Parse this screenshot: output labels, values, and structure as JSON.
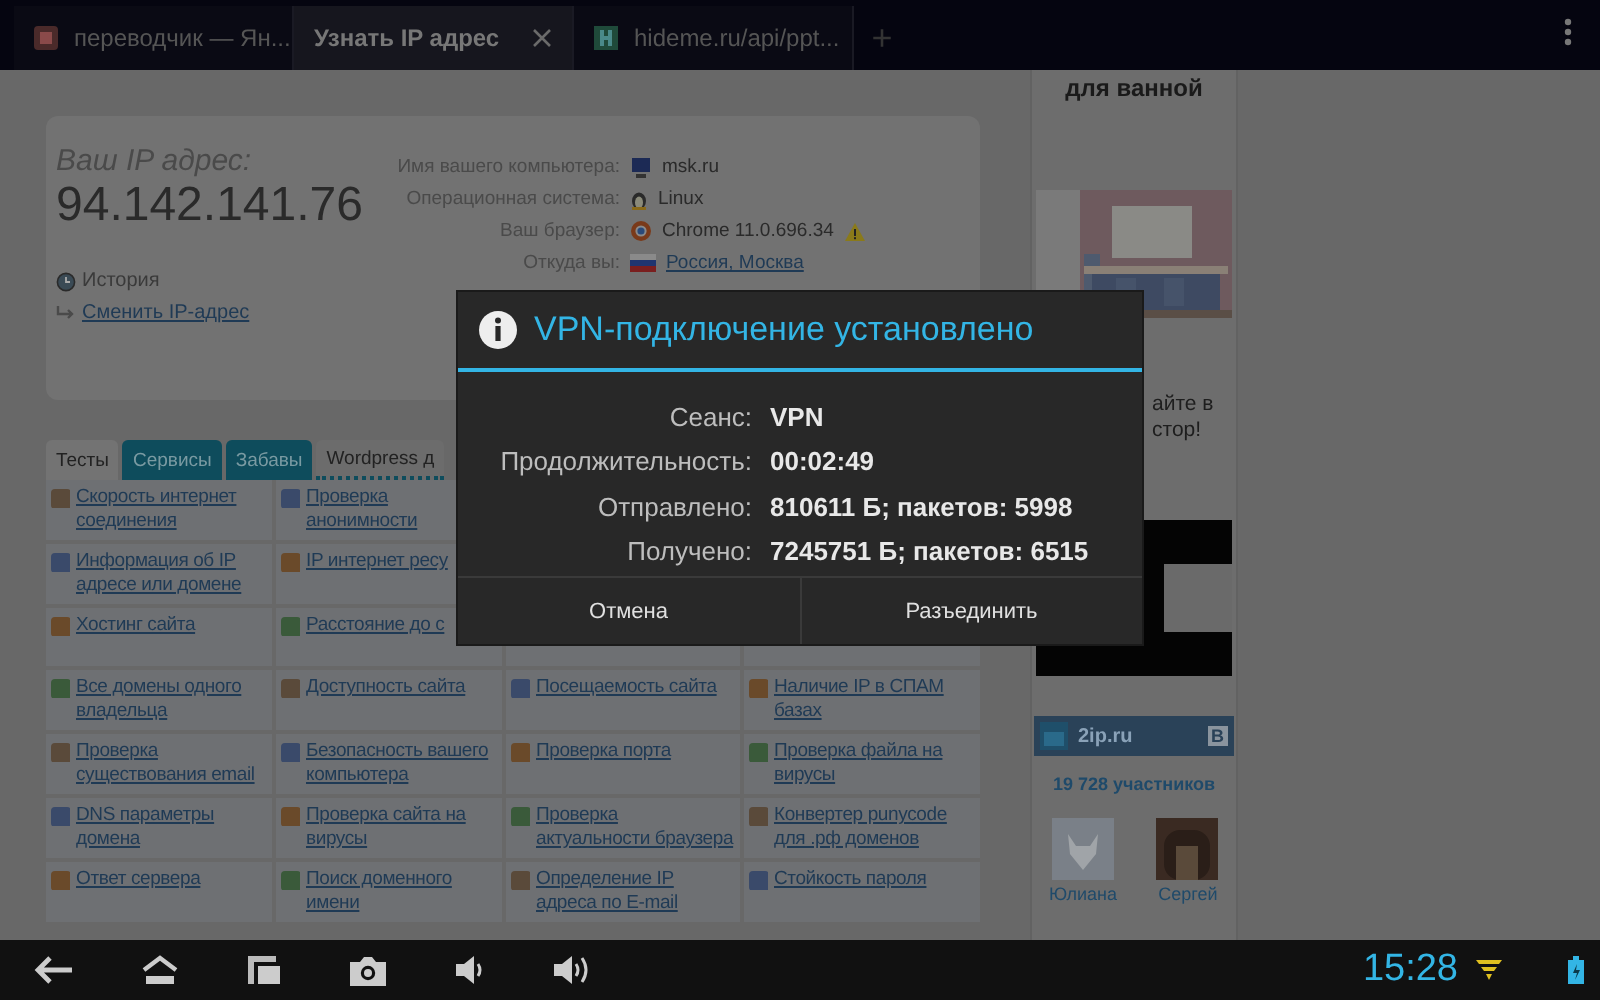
{
  "browser_tabs": [
    {
      "title": "переводчик — Ян...",
      "selected": false,
      "kind": "yandex"
    },
    {
      "title": "Узнать IP адрес",
      "selected": true,
      "kind": "none"
    },
    {
      "title": "hideme.ru/api/ppt...",
      "selected": false,
      "kind": "hideme"
    }
  ],
  "new_tab": "+",
  "ip_panel": {
    "caption": "Ваш IP адрес:",
    "ip": "94.142.141.76",
    "info": [
      {
        "label": "Имя вашего компьютера:",
        "value": "msk.ru",
        "kind": "computer",
        "warning": false
      },
      {
        "label": "Операционная система:",
        "value": "Linux",
        "kind": "os",
        "warning": false
      },
      {
        "label": "Ваш браузер:",
        "value": "Chrome 11.0.696.34",
        "kind": "browser",
        "warning": true
      },
      {
        "label": "Откуда вы:",
        "value": "Россия, Москва",
        "kind": "location",
        "warning": false
      }
    ],
    "history": "История",
    "change_ip": "Сменить IP-адрес"
  },
  "section_tabs": [
    {
      "label": "Тесты",
      "selected": true,
      "kind": "tab"
    },
    {
      "label": "Сервисы",
      "selected": false,
      "kind": "tab"
    },
    {
      "label": "Забавы",
      "selected": false,
      "kind": "tab"
    },
    {
      "label": "Wordpress д",
      "selected": false,
      "kind": "plain"
    }
  ],
  "links": [
    [
      "Скорость интернет соединения",
      "Проверка анонимности"
    ],
    [
      "Информация об IP адресе или домене",
      "IP интернет ресу"
    ],
    [
      "Хостинг сайта",
      "Расстояние до с"
    ],
    [
      "Все домены одного владельца",
      "Доступность сайта",
      "Посещаемость сайта",
      "Наличие IP в СПАМ базах"
    ],
    [
      "Проверка существования email",
      "Безопасность вашего компьютера",
      "Проверка порта",
      "Проверка файла на вирусы"
    ],
    [
      "DNS параметры домена",
      "Проверка сайта на вирусы",
      "Проверка актуальности браузера",
      "Конвертер punycode для .рф доменов"
    ],
    [
      "Ответ сервера",
      "Поиск доменного имени",
      "Определение IP адреса по E-mail",
      "Стойкость пароля"
    ]
  ],
  "sidebar": {
    "ad_title": "для ванной",
    "ad_text": [
      "айте в",
      "стор!"
    ],
    "vk": {
      "name": "2ip.ru",
      "badge": "В",
      "members": "19 728 участников",
      "people": [
        "Юлиана",
        "Сергей"
      ]
    }
  },
  "dialog": {
    "title": "VPN-подключение установлено",
    "rows": [
      {
        "label": "Сеанс:",
        "value": "VPN"
      },
      {
        "label": "Продолжительность:",
        "value": "00:02:49"
      },
      {
        "label": "Отправлено:",
        "value": "810611 Б; пакетов: 5998"
      },
      {
        "label": "Получено:",
        "value": "7245751 Б; пакетов: 6515"
      }
    ],
    "buttons": [
      "Отмена",
      "Разъединить"
    ]
  },
  "status": {
    "time": "15:28"
  }
}
